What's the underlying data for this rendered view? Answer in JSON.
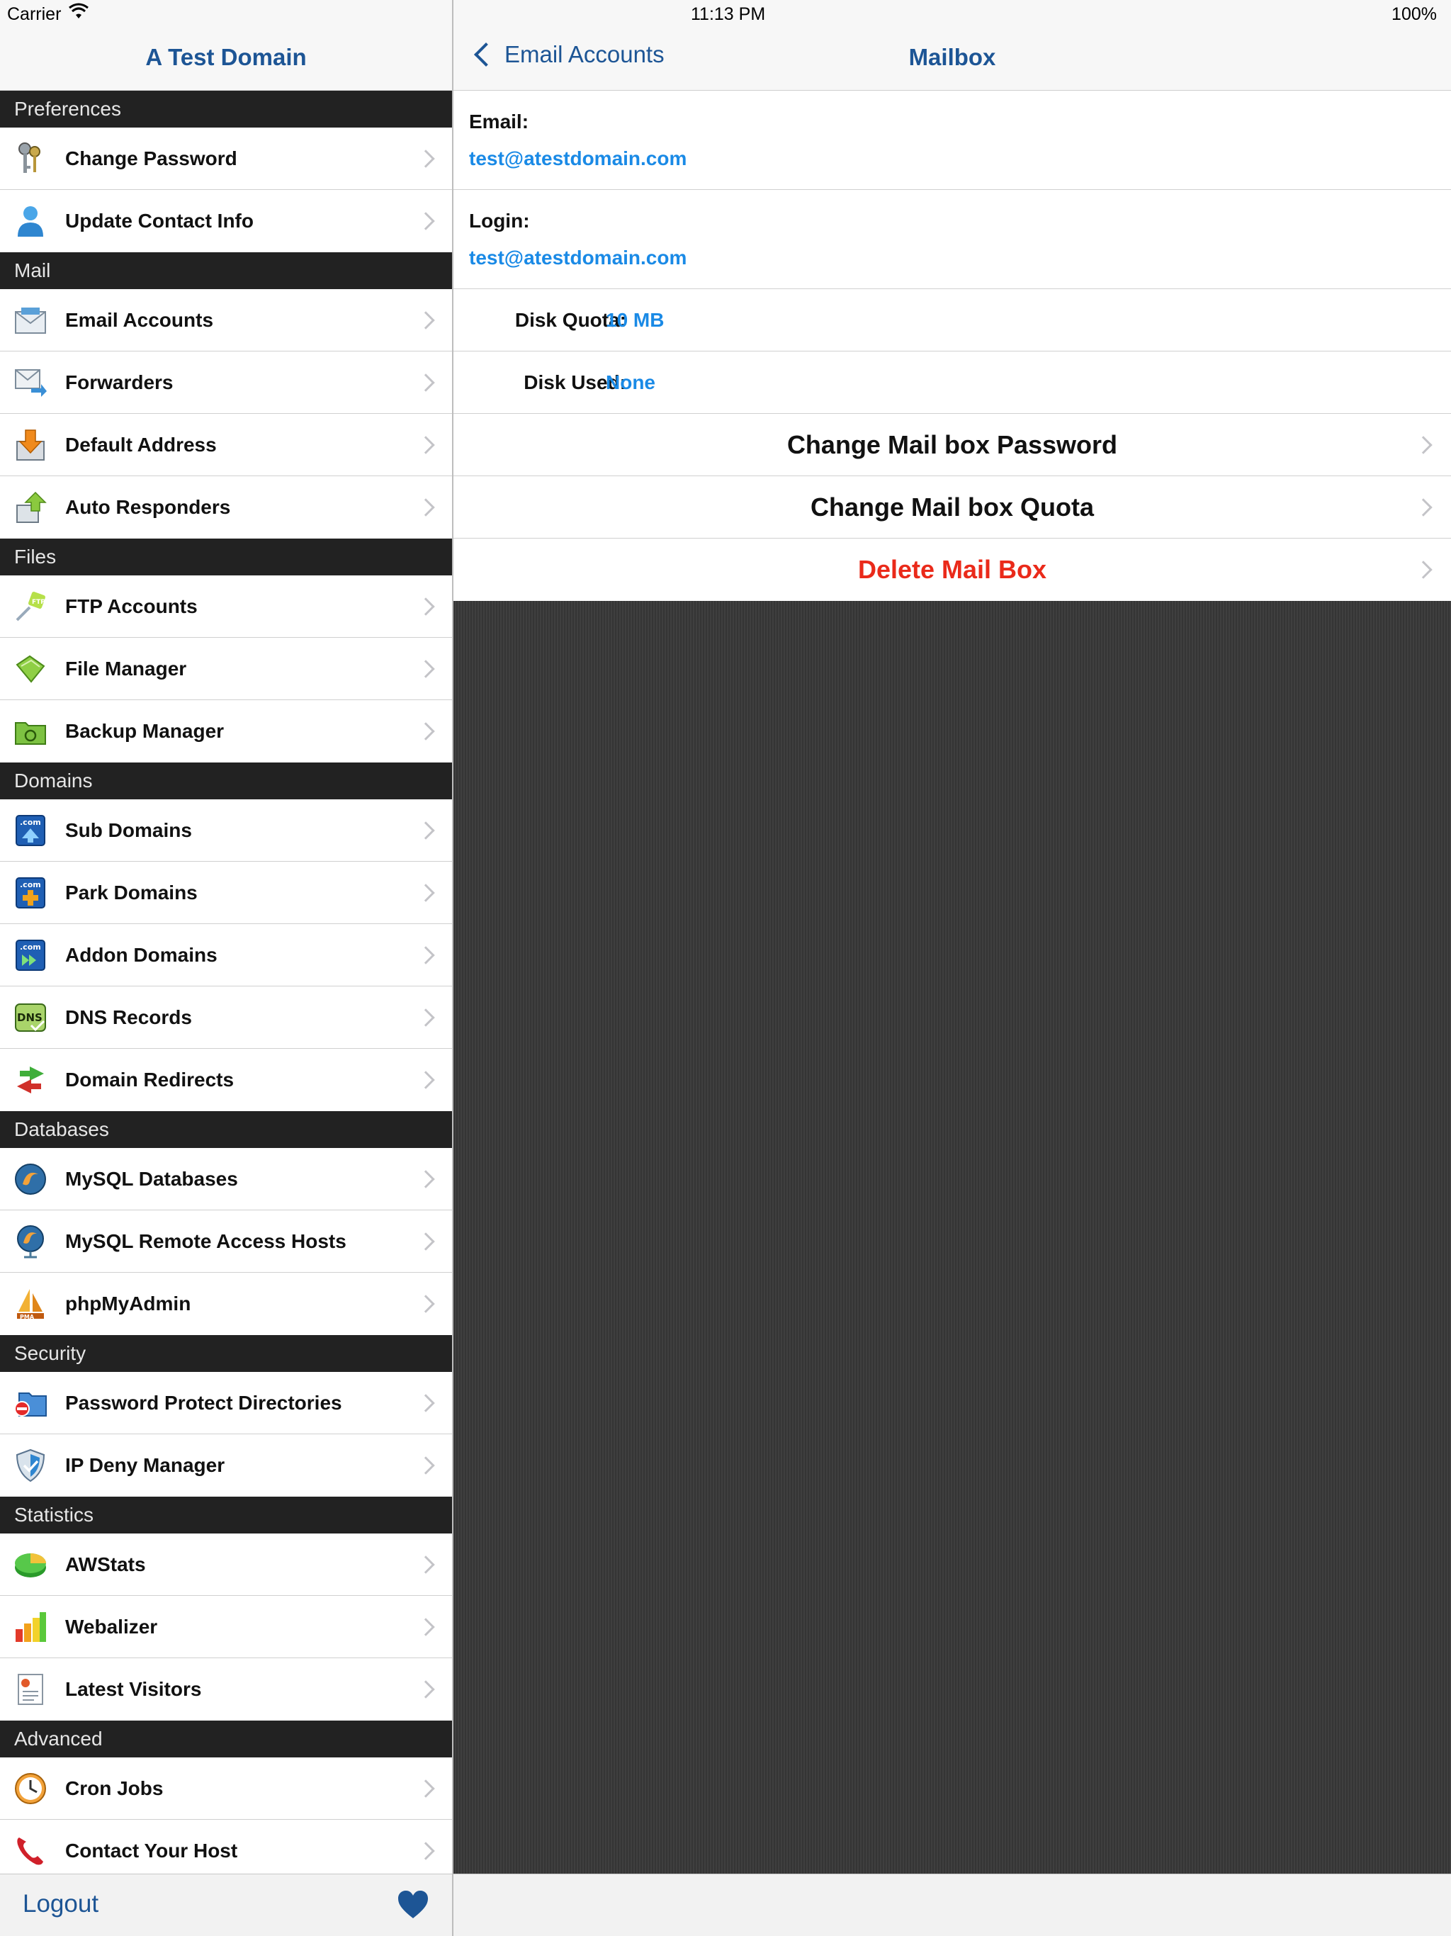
{
  "status": {
    "carrier": "Carrier",
    "time": "11:13 PM",
    "battery": "100%"
  },
  "sidebar": {
    "title": "A Test Domain",
    "sections": [
      {
        "title": "Preferences",
        "items": [
          {
            "label": "Change Password",
            "icon": "keys-icon"
          },
          {
            "label": "Update Contact Info",
            "icon": "person-icon"
          }
        ]
      },
      {
        "title": "Mail",
        "items": [
          {
            "label": "Email Accounts",
            "icon": "envelope-icon"
          },
          {
            "label": "Forwarders",
            "icon": "forward-mail-icon"
          },
          {
            "label": "Default Address",
            "icon": "inbox-down-arrow-icon"
          },
          {
            "label": "Auto Responders",
            "icon": "auto-reply-icon"
          }
        ]
      },
      {
        "title": "Files",
        "items": [
          {
            "label": "FTP Accounts",
            "icon": "ftp-plug-icon"
          },
          {
            "label": "File Manager",
            "icon": "folder-icon"
          },
          {
            "label": "Backup Manager",
            "icon": "backup-folder-icon"
          }
        ]
      },
      {
        "title": "Domains",
        "items": [
          {
            "label": "Sub Domains",
            "icon": "com-up-icon"
          },
          {
            "label": "Park Domains",
            "icon": "com-plus-icon"
          },
          {
            "label": "Addon Domains",
            "icon": "com-forward-icon"
          },
          {
            "label": "DNS Records",
            "icon": "dns-icon"
          },
          {
            "label": "Domain Redirects",
            "icon": "redirect-arrows-icon"
          }
        ]
      },
      {
        "title": "Databases",
        "items": [
          {
            "label": "MySQL Databases",
            "icon": "mysql-icon"
          },
          {
            "label": "MySQL Remote Access Hosts",
            "icon": "mysql-remote-icon"
          },
          {
            "label": "phpMyAdmin",
            "icon": "phpmyadmin-icon"
          }
        ]
      },
      {
        "title": "Security",
        "items": [
          {
            "label": "Password Protect Directories",
            "icon": "locked-folder-icon"
          },
          {
            "label": "IP Deny Manager",
            "icon": "shield-icon"
          }
        ]
      },
      {
        "title": "Statistics",
        "items": [
          {
            "label": "AWStats",
            "icon": "pie-chart-icon"
          },
          {
            "label": "Webalizer",
            "icon": "bar-chart-icon"
          },
          {
            "label": "Latest Visitors",
            "icon": "report-icon"
          }
        ]
      },
      {
        "title": "Advanced",
        "items": [
          {
            "label": "Cron Jobs",
            "icon": "clock-icon"
          },
          {
            "label": "Contact Your Host",
            "icon": "phone-icon"
          }
        ]
      }
    ],
    "logout_label": "Logout"
  },
  "detail": {
    "back_label": "Email Accounts",
    "title": "Mailbox",
    "email_label": "Email:",
    "email_value": "test@atestdomain.com",
    "login_label": "Login:",
    "login_value": "test@atestdomain.com",
    "quota_label": "Disk Quota:",
    "quota_value": "10 MB",
    "used_label": "Disk Used:",
    "used_value": "None",
    "actions": [
      {
        "label": "Change Mail box Password",
        "style": "normal"
      },
      {
        "label": "Change Mail box Quota",
        "style": "normal"
      },
      {
        "label": "Delete Mail Box",
        "style": "danger"
      }
    ]
  },
  "colors": {
    "accent": "#1d5595",
    "link": "#1a8ae6",
    "danger": "#ea2a1a",
    "section": "#222222"
  }
}
